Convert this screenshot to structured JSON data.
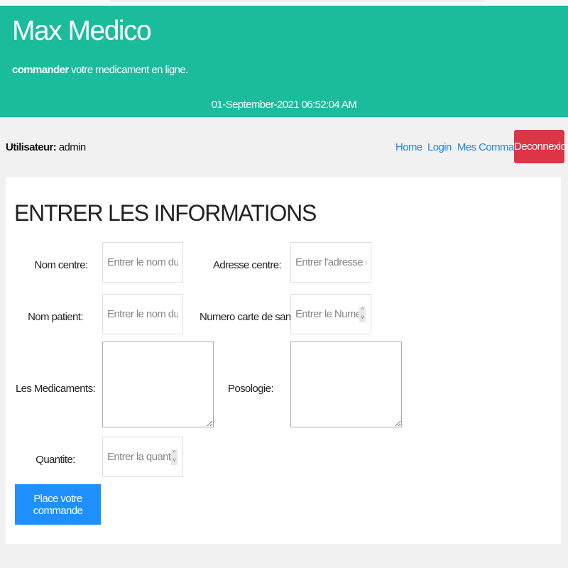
{
  "header": {
    "title": "Max Medico",
    "tagline_bold": "commander",
    "tagline_rest": " votre medicament en ligne.",
    "datetime": "01-September-2021 06:52:04 AM",
    "color": "#1abc9c"
  },
  "nav": {
    "user_label": "Utilisateur:",
    "user_name": " admin",
    "links": [
      "Home",
      "Login",
      "Mes Commande"
    ],
    "logout": "Deconnexion"
  },
  "form": {
    "title": "ENTRER LES INFORMATIONS",
    "fields": {
      "nom_centre": {
        "label": "Nom centre:",
        "placeholder": "Entrer le nom du centre"
      },
      "adresse_centre": {
        "label": "Adresse centre:",
        "placeholder": "Entrer l'adresse du centre"
      },
      "nom_patient": {
        "label": "Nom patient:",
        "placeholder": "Entrer le nom du patient"
      },
      "numero_carte": {
        "label": "Numero carte de sante:",
        "placeholder": "Entrer le Numero carte"
      },
      "medicaments": {
        "label": "Les Medicaments:"
      },
      "posologie": {
        "label": "Posologie:"
      },
      "quantite": {
        "label": "Quantite:",
        "placeholder": "Entrer la quantite ici"
      }
    },
    "submit": "Place votre commande"
  }
}
